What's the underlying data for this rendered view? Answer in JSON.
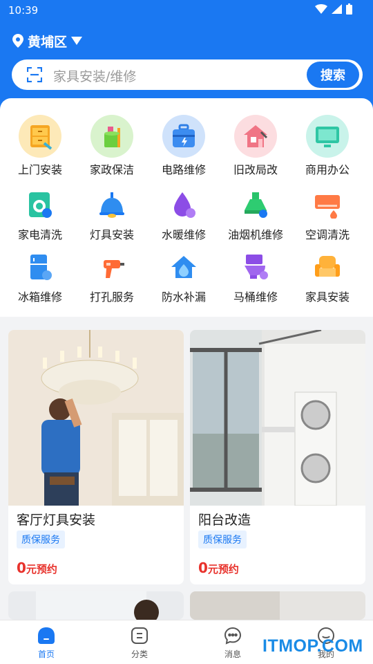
{
  "status_bar": {
    "time": "10:39"
  },
  "location": {
    "district": "黄埔区"
  },
  "search": {
    "placeholder": "家具安装/维修",
    "button_label": "搜索"
  },
  "categories_row1": [
    {
      "label": "上门安装",
      "icon": "cabinet-install-icon"
    },
    {
      "label": "家政保洁",
      "icon": "cleaning-bucket-icon"
    },
    {
      "label": "电路维修",
      "icon": "toolbox-icon"
    },
    {
      "label": "旧改局改",
      "icon": "house-renovation-icon"
    },
    {
      "label": "商用办公",
      "icon": "monitor-icon"
    }
  ],
  "categories_row2": [
    {
      "label": "家电清洗",
      "icon": "washing-machine-icon"
    },
    {
      "label": "灯具安装",
      "icon": "lamp-icon"
    },
    {
      "label": "水暖维修",
      "icon": "water-drop-icon"
    },
    {
      "label": "油烟机维修",
      "icon": "range-hood-icon"
    },
    {
      "label": "空调清洗",
      "icon": "air-conditioner-icon"
    }
  ],
  "categories_row3": [
    {
      "label": "冰箱维修",
      "icon": "fridge-icon"
    },
    {
      "label": "打孔服务",
      "icon": "drill-icon"
    },
    {
      "label": "防水补漏",
      "icon": "waterproof-house-icon"
    },
    {
      "label": "马桶维修",
      "icon": "toilet-icon"
    },
    {
      "label": "家具安装",
      "icon": "sofa-icon"
    }
  ],
  "services": [
    {
      "title": "客厅灯具安装",
      "tag": "质保服务",
      "price_num": "0",
      "price_unit": "元预约"
    },
    {
      "title": "阳台改造",
      "tag": "质保服务",
      "price_num": "0",
      "price_unit": "元预约"
    }
  ],
  "tabbar": [
    {
      "label": "首页",
      "icon": "home-icon",
      "active": true
    },
    {
      "label": "分类",
      "icon": "category-icon"
    },
    {
      "label": "消息",
      "icon": "message-icon"
    },
    {
      "label": "我的",
      "icon": "profile-icon"
    }
  ],
  "watermark": "ITMOP.COM",
  "colors": {
    "primary": "#1a78f2",
    "price": "#e8322c",
    "tag_bg": "#e8f2ff"
  }
}
